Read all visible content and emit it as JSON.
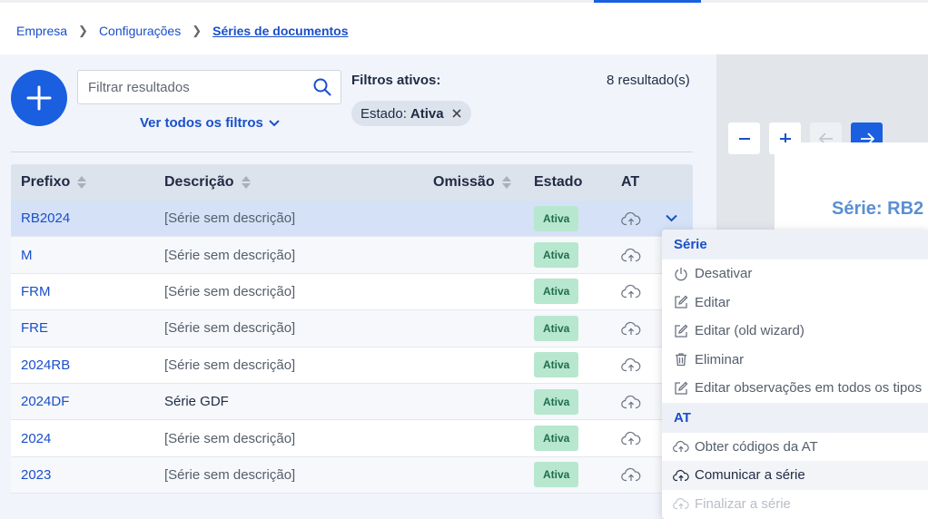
{
  "breadcrumb": [
    "Empresa",
    "Configurações",
    "Séries de documentos"
  ],
  "toolbar": {
    "search_placeholder": "Filtrar resultados",
    "all_filters_label": "Ver todos os filtros",
    "active_filters_label": "Filtros ativos:",
    "results_count": "8 resultado(s)",
    "chip_key": "Estado:",
    "chip_value": "Ativa"
  },
  "table": {
    "headers": [
      "Prefixo",
      "Descrição",
      "Omissão",
      "Estado",
      "AT"
    ],
    "rows": [
      {
        "prefix": "RB2024",
        "description": "[Série sem descrição]",
        "state": "Ativa"
      },
      {
        "prefix": "M",
        "description": "[Série sem descrição]",
        "state": "Ativa"
      },
      {
        "prefix": "FRM",
        "description": "[Série sem descrição]",
        "state": "Ativa"
      },
      {
        "prefix": "FRE",
        "description": "[Série sem descrição]",
        "state": "Ativa"
      },
      {
        "prefix": "2024RB",
        "description": "[Série sem descrição]",
        "state": "Ativa"
      },
      {
        "prefix": "2024DF",
        "description": "Série GDF",
        "state": "Ativa"
      },
      {
        "prefix": "2024",
        "description": "[Série sem descrição]",
        "state": "Ativa"
      },
      {
        "prefix": "2023",
        "description": "[Série sem descrição]",
        "state": "Ativa"
      }
    ]
  },
  "preview": {
    "title": "Série: RB2"
  },
  "menu": {
    "section1": "Série",
    "items1": [
      "Desativar",
      "Editar",
      "Editar (old wizard)",
      "Eliminar",
      "Editar observações em todos os tipos"
    ],
    "section2": "AT",
    "items2": [
      "Obter códigos da AT",
      "Comunicar a série",
      "Finalizar a série"
    ]
  },
  "colors": {
    "accent": "#1a5fe0",
    "badge_bg": "#b8e7cf",
    "badge_text": "#1f6e4b"
  }
}
